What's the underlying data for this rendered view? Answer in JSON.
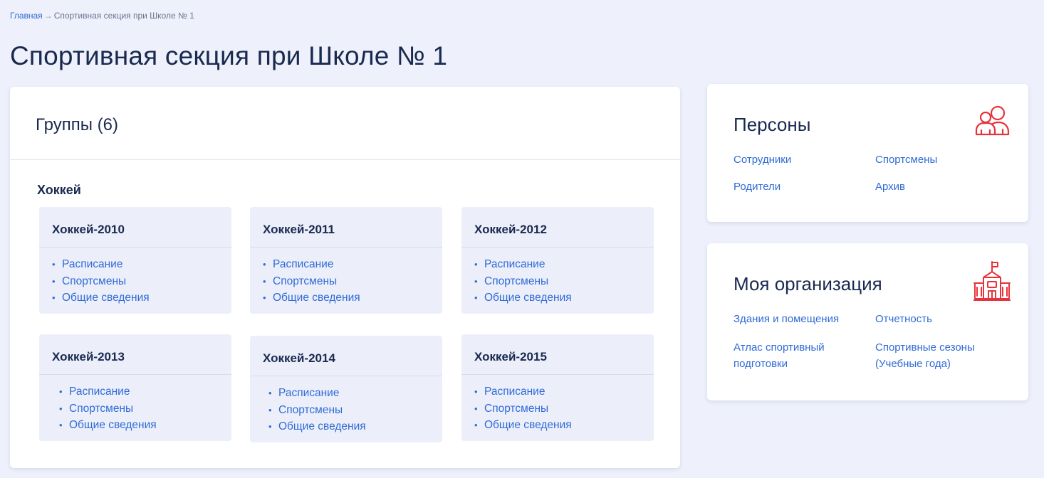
{
  "breadcrumb": {
    "home": "Главная",
    "separator": "→",
    "current": "Спортивная секция при Школе № 1"
  },
  "page_title": "Спортивная секция при Школе № 1",
  "groups_card": {
    "title": "Группы (6)",
    "sport": "Хоккей",
    "groups": [
      {
        "name": "Хоккей-2010",
        "links": [
          "Расписание",
          "Спортсмены",
          "Общие сведения"
        ]
      },
      {
        "name": "Хоккей-2011",
        "links": [
          "Расписание",
          "Спортсмены",
          "Общие сведения"
        ]
      },
      {
        "name": "Хоккей-2012",
        "links": [
          "Расписание",
          "Спортсмены",
          "Общие сведения"
        ]
      },
      {
        "name": "Хоккей-2013",
        "links": [
          "Расписание",
          "Спортсмены",
          "Общие сведения"
        ]
      },
      {
        "name": "Хоккей-2014",
        "links": [
          "Расписание",
          "Спортсмены",
          "Общие сведения"
        ]
      },
      {
        "name": "Хоккей-2015",
        "links": [
          "Расписание",
          "Спортсмены",
          "Общие сведения"
        ]
      }
    ],
    "bullet": "•"
  },
  "persons_card": {
    "title": "Персоны",
    "icon": "persons-icon",
    "links": [
      "Сотрудники",
      "Спортсмены",
      "Родители",
      "Архив"
    ]
  },
  "org_card": {
    "title": "Моя организация",
    "icon": "school-building-icon",
    "links": [
      "Здания и помещения",
      "Отчетность",
      "Атлас спортивный подготовки",
      "Спортивные сезоны (Учебные года)"
    ]
  },
  "colors": {
    "background": "#eef0fb",
    "link": "#2f6bd6",
    "heading": "#1a2a4f",
    "accent_icon": "#e8323c",
    "group_bg": "#eceffa"
  }
}
